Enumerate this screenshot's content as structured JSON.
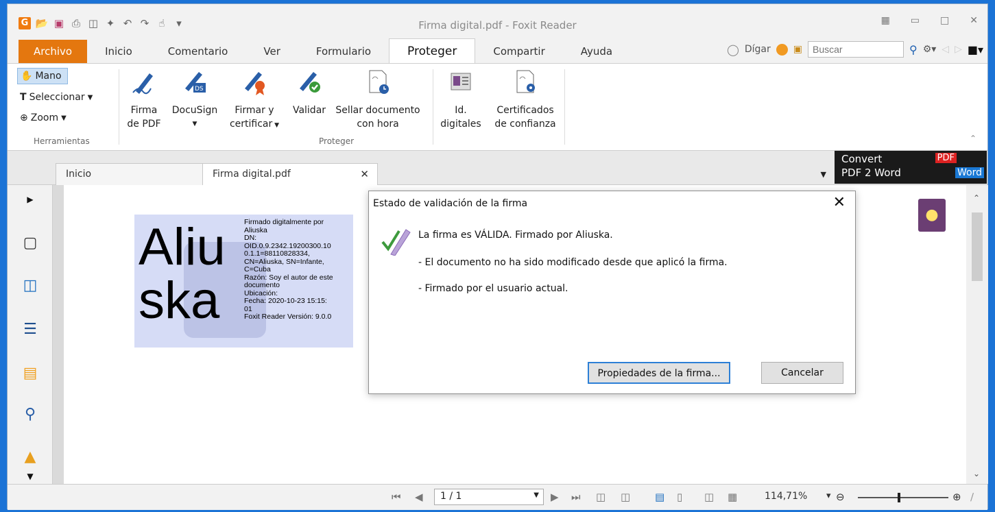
{
  "window": {
    "title": "Firma digital.pdf - Foxit Reader"
  },
  "quick_access": {
    "icons": [
      "foxit-logo-icon",
      "open-folder-icon",
      "save-icon",
      "print-icon",
      "scan-icon",
      "new-icon",
      "undo-icon",
      "redo-icon",
      "hand-icon",
      "customize-icon"
    ]
  },
  "tabs": [
    "Archivo",
    "Inicio",
    "Comentario",
    "Ver",
    "Formulario",
    "Proteger",
    "Compartir",
    "Ayuda"
  ],
  "tabs_active": "Proteger",
  "tellme": "Dígar",
  "search": {
    "placeholder": "Buscar"
  },
  "ribbon": {
    "tools": {
      "hand": "Mano",
      "select": "Seleccionar",
      "zoom": "Zoom",
      "group_label": "Herramientas"
    },
    "protect": {
      "sign_pdf_1": "Firma",
      "sign_pdf_2": "de PDF",
      "docusign": "DocuSign",
      "sign_certify_1": "Firmar y",
      "sign_certify_2": "certificar",
      "validate": "Validar",
      "timestamp_1": "Sellar documento",
      "timestamp_2": "con hora",
      "group_label": "Proteger"
    },
    "ids": {
      "digital_ids_1": "Id.",
      "digital_ids_2": "digitales",
      "trusted_1": "Certificados",
      "trusted_2": "de confianza"
    }
  },
  "doc_tabs": {
    "home": "Inicio",
    "file": "Firma digital.pdf"
  },
  "convert_banner": {
    "line1": "Convert",
    "line2": "PDF 2 Word",
    "pdf": "PDF",
    "word": "Word"
  },
  "signature": {
    "name_line1": "Aliu",
    "name_line2": "ska",
    "details": [
      "Firmado digitalmente por",
      "Aliuska",
      "DN:",
      "OID.0.9.2342.19200300.10",
      "0.1.1=88110828334,",
      "CN=Aliuska, SN=Infante,",
      "C=Cuba",
      "Razón: Soy el autor de este",
      "documento",
      "Ubicación:",
      "Fecha: 2020-10-23 15:15:",
      "01",
      "Foxit Reader Versión: 9.0.0"
    ]
  },
  "dialog": {
    "title": "Estado de validación de la firma",
    "line1": "La firma es VÁLIDA. Firmado por Aliuska.",
    "line2": "- El documento no ha sido modificado desde que aplicó la firma.",
    "line3": "- Firmado por el usuario actual.",
    "properties_button": "Propiedades de la firma...",
    "cancel_button": "Cancelar"
  },
  "status": {
    "page": "1 / 1",
    "zoom": "114,71%"
  }
}
